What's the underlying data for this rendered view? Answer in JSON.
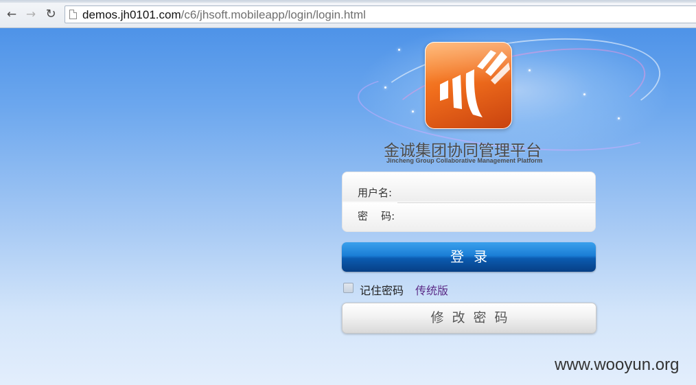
{
  "browser": {
    "url_host": "demos.jh0101.com",
    "url_path": "/c6/jhsoft.mobileapp/login/login.html",
    "back_icon": "arrow-left",
    "forward_icon": "arrow-right",
    "reload_icon": "reload",
    "page_icon": "document"
  },
  "branding": {
    "title_cn": "金诚集团协同管理平台",
    "title_en": "Jincheng Group Collaborative Management Platform",
    "logo_colors": [
      "#ff9a3c",
      "#c8420f"
    ]
  },
  "form": {
    "username_label": "用户名:",
    "username_value": "",
    "password_label": "密    码:",
    "password_value": ""
  },
  "actions": {
    "login_label": "登录",
    "remember_label": "记住密码",
    "remember_checked": false,
    "classic_link": "传统版",
    "change_password_label": "修改密码"
  },
  "colors": {
    "login_button": "#1b7ed6",
    "link": "#5b2a86"
  },
  "watermark": "www.wooyun.org"
}
